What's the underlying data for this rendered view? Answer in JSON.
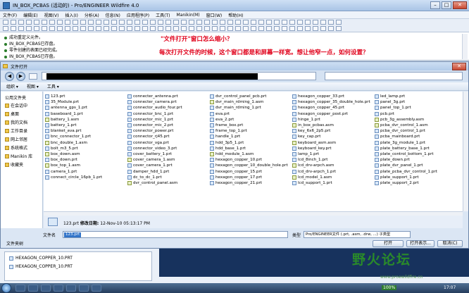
{
  "proe": {
    "window_title": "IN_BOX_PCBAS (活动的) - Pro/ENGINEER Wildfire 4.0",
    "menu": [
      "文件(F)",
      "编辑(E)",
      "视图(V)",
      "插入(I)",
      "分析(A)",
      "信息(N)",
      "应用程序(P)",
      "工具(T)",
      "Manikin(M)",
      "窗口(W)",
      "帮助(H)"
    ],
    "messages": [
      "成功重定义元件。",
      "IN_BOX_PCBAS已存盘。",
      "零件创建的表面已经完成。",
      "IN_BOX_PCBAS已存盘。"
    ],
    "question_title": "\"文件打开\"窗口怎么缩小？",
    "question_body": "每次打开文件的时候，这个窗口都是和屏幕一样宽。想让他窄一点，如何设置？"
  },
  "dialog": {
    "title": "文件打开",
    "organize": "组织 ▾",
    "views": "视图 ▾",
    "tools": "工具 ▾",
    "sidebar": [
      "公用文件夹",
      "在会话中",
      "桌面",
      "我的文档",
      "工作目录",
      "网上邻居",
      "系统格式",
      "Manikin 库",
      "收藏夹"
    ],
    "columns": [
      [
        "123.prt",
        "35_Module.prt",
        "antenna_gps_1.prt",
        "baseboard_1.prt",
        "battery_1.asm",
        "battery_1.prt",
        "blanket_ava.prt",
        "bnc_connector_1.prt",
        "bnc_double_1.asm",
        "bolt_m3_5.prt",
        "box_down.asm",
        "box_down.prt",
        "box_top_1.asm",
        "camera_1.prt",
        "connect_circle_16pb_1.prt"
      ],
      [
        "connecter_antenna.prt",
        "connecter_camera.prt",
        "connector_audio_four.prt",
        "connector_bnc_1.prt",
        "connector_mic_1.prt",
        "connector_mic_2.prt",
        "connector_power.prt",
        "connector_rj45.prt",
        "connector_vga.prt",
        "connector_video_3.prt",
        "cover_battery_1.prt",
        "cover_camera_1.asm",
        "cover_camera_1.prt",
        "damper_hdd_1.prt",
        "dc_to_dc_1.prt",
        "dvr_control_panel.asm"
      ],
      [
        "dvr_control_panel_pcb.prt",
        "dvr_main_rdming_1.asm",
        "dvr_main_rdming_1.prt",
        "eva.prt",
        "eva_2.prt",
        "frame_box.prt",
        "frame_top_1.prt",
        "handle_1.prt",
        "hdd_3p5_1.prt",
        "hdd_base_1.prt",
        "hdd_module_1.asm",
        "hexagon_copper_10.prt",
        "hexagon_copper_10_double_hole.prt",
        "hexagon_copper_15.prt",
        "hexagon_copper_17.prt",
        "hexagon_copper_21.prt"
      ],
      [
        "hexagon_copper_33.prt",
        "hexagon_copper_35_double_hole.prt",
        "hexagon_copper_45.prt",
        "hexagon_copper_post.prt",
        "hinge_1.prt",
        "in_box_pcbas.asm",
        "key_6x6_2p5.prt",
        "key_cap.prt",
        "keyboard_asm.asm",
        "keyboard_key.prt",
        "lamp_1.prt",
        "lcd_8inch_1.prt",
        "lcd_drv-arpch.asm",
        "lcd_drv-arpch_1.prt",
        "lcd_model_1.asm",
        "lcd_support_1.prt"
      ],
      [
        "led_lamp.prt",
        "panel_3g.prt",
        "panel_top_1.prt",
        "pcb.prt",
        "pcb_3g_assembly.asm",
        "pcba_dvr_control_1.asm",
        "pcba_dvr_control_1.prt",
        "pcba_mainboard.prt",
        "plate_3g_module_1.prt",
        "plate_battery_base_1.prt",
        "plate_control_bottom_1.prt",
        "plate_down.prt",
        "plate_dvr_panel_1.prt",
        "plate_pcba_dvr_control_1.prt",
        "plate_support_1.prt",
        "plate_support_2.prt"
      ]
    ],
    "detail_name": "123.prt",
    "detail_label": "修改日期:",
    "detail_date": "12-Nov-10 05:13:17 PM",
    "filename_label": "文件名",
    "filename_value": "123.prt",
    "type_label": "类型",
    "type_value": "Pro/ENGINEER文件 (.prt, .asm, .drw, ...) 子类型",
    "folder_tree": "文件夹树",
    "open": "打开",
    "open_rep": "打开表示...",
    "cancel": "取消(C)"
  },
  "lower": {
    "items": [
      "HEXAGON_COPPER_10.PRT",
      "HEXAGON_COPPER_10.PRT"
    ],
    "logo": "野火论坛",
    "logo_sub": "www.proewildfire.cn"
  },
  "taskbar": {
    "percent": "100%",
    "clock": "17:07"
  }
}
